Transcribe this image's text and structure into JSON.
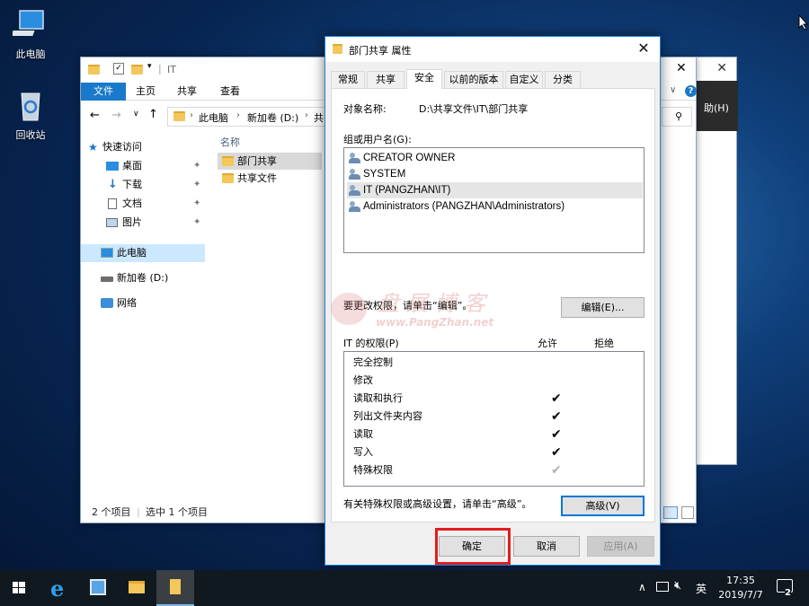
{
  "desktop": {
    "icons": [
      {
        "label": "此电脑"
      },
      {
        "label": "回收站"
      }
    ]
  },
  "background_window": {
    "help_text": "助(H)"
  },
  "explorer": {
    "title": "IT",
    "ribbon_tabs": [
      "文件",
      "主页",
      "共享",
      "查看"
    ],
    "breadcrumb": [
      "此电脑",
      "新加卷 (D:)",
      "共"
    ],
    "nav": {
      "quick_access": "快速访问",
      "items": [
        "桌面",
        "下载",
        "文档",
        "图片"
      ],
      "this_pc": "此电脑",
      "drive": "新加卷 (D:)",
      "network": "网络"
    },
    "column_header": "名称",
    "files": [
      "部门共享",
      "共享文件"
    ],
    "status": {
      "count": "2 个项目",
      "selected": "选中 1 个项目"
    }
  },
  "dialog": {
    "title": "部门共享 属性",
    "tabs": [
      "常规",
      "共享",
      "安全",
      "以前的版本",
      "自定义",
      "分类"
    ],
    "active_tab": "安全",
    "object_label": "对象名称:",
    "object_value": "D:\\共享文件\\IT\\部门共享",
    "group_label": "组或用户名(G):",
    "users": [
      "CREATOR OWNER",
      "SYSTEM",
      "IT (PANGZHAN\\IT)",
      "Administrators (PANGZHAN\\Administrators)"
    ],
    "change_hint": "要更改权限，请单击“编辑”。",
    "edit_button": "编辑(E)...",
    "perm_title": "IT 的权限(P)",
    "allow_header": "允许",
    "deny_header": "拒绝",
    "permissions": [
      {
        "name": "完全控制",
        "allow": false
      },
      {
        "name": "修改",
        "allow": false
      },
      {
        "name": "读取和执行",
        "allow": true
      },
      {
        "name": "列出文件夹内容",
        "allow": true
      },
      {
        "name": "读取",
        "allow": true
      },
      {
        "name": "写入",
        "allow": true
      },
      {
        "name": "特殊权限",
        "allow": "inherited"
      }
    ],
    "advanced_hint": "有关特殊权限或高级设置，请单击“高级”。",
    "advanced_button": "高级(V)",
    "ok_button": "确定",
    "cancel_button": "取消",
    "apply_button": "应用(A)"
  },
  "watermark": {
    "title": "盘展博客",
    "url": "www.PangZhan.net"
  },
  "taskbar": {
    "time": "17:35",
    "date": "2019/7/7",
    "ime": "英",
    "notifications": "2"
  },
  "colors": {
    "accent": "#0078d7",
    "highlight": "#e11d1d",
    "taskbar": "#101820"
  }
}
